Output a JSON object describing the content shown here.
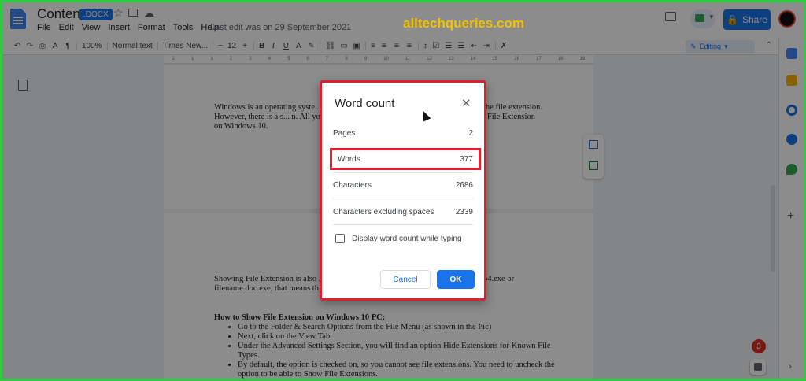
{
  "header": {
    "title": "Content",
    "badge": ".DOCX",
    "menu": [
      "File",
      "Edit",
      "View",
      "Insert",
      "Format",
      "Tools",
      "Help"
    ],
    "last_edit": "Last edit was on 29 September 2021",
    "share_label": "Share"
  },
  "watermark": "alltechqueries.com",
  "toolbar": {
    "zoom": "100%",
    "style": "Normal text",
    "font": "Times New...",
    "font_size": "12",
    "mode": "Editing"
  },
  "ruler_ticks": [
    "2",
    "1",
    "1",
    "2",
    "3",
    "4",
    "5",
    "6",
    "7",
    "8",
    "9",
    "10",
    "11",
    "12",
    "13",
    "14",
    "15",
    "16",
    "17",
    "18",
    "19"
  ],
  "document": {
    "page1_text": "Windows is an operating syste... types of files. Whenever the users want to che... the file extension. However, there is a s... n. All you need to do is enable File Extensions. ... to Show File Extension on Windows 10.",
    "page2_text": "Showing File Extension is also ... this in our previous article about Ransomw... mp4.exe or filename.doc.exe, that means th... on.",
    "heading": "How to Show File Extension on Windows 10 PC:",
    "bullets": [
      "Go to the Folder & Search Options from the File Menu (as shown in the Pic)",
      "Next, click on the View Tab.",
      "Under the Advanced Settings Section, you will find an option Hide Extensions for Known File Types.",
      "By default, the option is checked on, so you cannot see file extensions. You need to uncheck the option to be able to Show File Extensions."
    ]
  },
  "dialog": {
    "title": "Word count",
    "rows": [
      {
        "label": "Pages",
        "value": "2"
      },
      {
        "label": "Words",
        "value": "377"
      },
      {
        "label": "Characters",
        "value": "2686"
      },
      {
        "label": "Characters excluding spaces",
        "value": "2339"
      }
    ],
    "checkbox_label": "Display word count while typing",
    "checkbox_checked": false,
    "cancel_label": "Cancel",
    "ok_label": "OK"
  },
  "notification_count": "3",
  "colors": {
    "accent": "#1a73e8",
    "highlight": "#e01e2d",
    "watermark": "#f2c200",
    "border": "#2ecc40"
  }
}
